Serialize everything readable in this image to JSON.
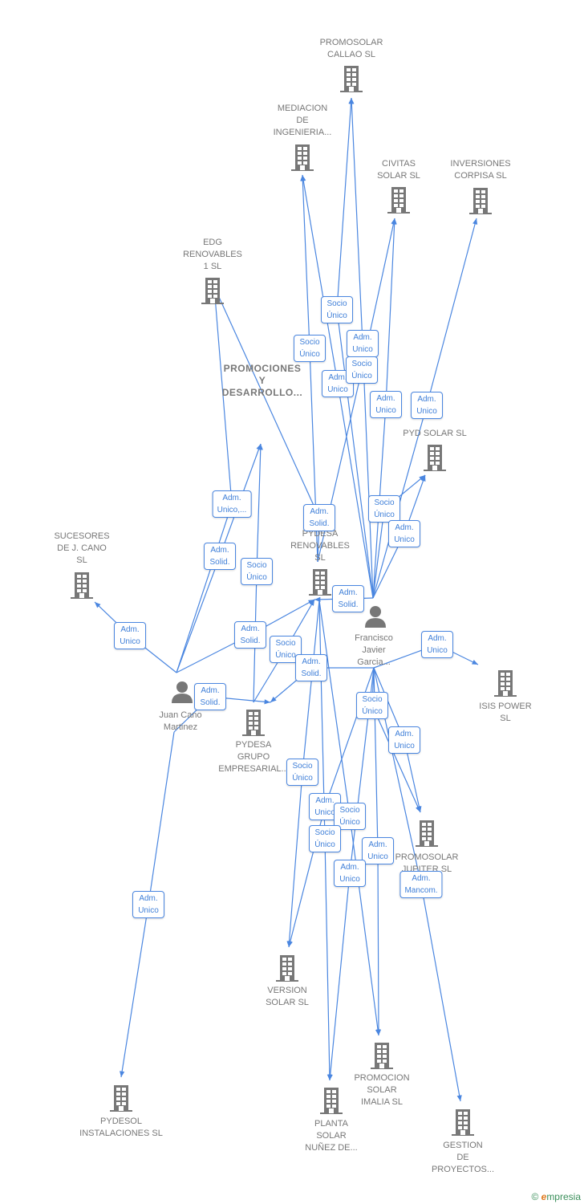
{
  "colors": {
    "edge": "#4a86e0",
    "node": "#777777",
    "brand_e": "#e07a1f",
    "brand": "#3a8f5a"
  },
  "companies": [
    {
      "id": "callao",
      "label": "PROMOSOLAR\nCALLAO  SL"
    },
    {
      "id": "mediacion",
      "label": "MEDIACION\nDE\nINGENIERIA..."
    },
    {
      "id": "civitas",
      "label": "CIVITAS\nSOLAR  SL"
    },
    {
      "id": "corpisa",
      "label": "INVERSIONES\nCORPISA  SL"
    },
    {
      "id": "edg",
      "label": "EDG\nRENOVABLES\n1  SL"
    },
    {
      "id": "promociones",
      "label": "PROMOCIONES\nY\nDESARROLLO..."
    },
    {
      "id": "pyd",
      "label": "PYD SOLAR  SL"
    },
    {
      "id": "sucesores",
      "label": "SUCESORES\nDE J.  CANO\nSL"
    },
    {
      "id": "pydesa_renov",
      "label": "PYDESA\nRENOVABLES\nSL"
    },
    {
      "id": "isis",
      "label": "ISIS POWER\nSL"
    },
    {
      "id": "pydesa_grupo",
      "label": "PYDESA\nGRUPO\nEMPRESARIAL..."
    },
    {
      "id": "jupiter",
      "label": "PROMOSOLAR\nJUPITER  SL"
    },
    {
      "id": "version",
      "label": "VERSION\nSOLAR  SL"
    },
    {
      "id": "imalia",
      "label": "PROMOCION\nSOLAR\nIMALIA  SL"
    },
    {
      "id": "pydesol",
      "label": "PYDESOL\nINSTALACIONES SL"
    },
    {
      "id": "planta",
      "label": "PLANTA\nSOLAR\nNUÑEZ DE..."
    },
    {
      "id": "gestion",
      "label": "GESTION\nDE\nPROYECTOS..."
    }
  ],
  "persons": [
    {
      "id": "francisco",
      "label": "Francisco\nJavier\nGarcia..."
    },
    {
      "id": "juan",
      "label": "Juan Cano\nMartinez"
    }
  ],
  "edges": [
    {
      "from": "francisco",
      "to": "callao",
      "label": "Socio\nÚnico"
    },
    {
      "from": "pydesa_renov",
      "to": "mediacion",
      "label": "Socio\nÚnico"
    },
    {
      "from": "francisco",
      "to": "mediacion",
      "label": "Adm.\nUnico"
    },
    {
      "from": "francisco",
      "to": "callao",
      "label": "Adm.\nUnico"
    },
    {
      "from": "pydesa_renov",
      "to": "civitas",
      "label": "Socio\nÚnico"
    },
    {
      "from": "francisco",
      "to": "civitas",
      "label": "Adm.\nUnico"
    },
    {
      "from": "francisco",
      "to": "corpisa",
      "label": "Adm.\nUnico"
    },
    {
      "from": "juan",
      "to": "edg",
      "label": "Adm.\nUnico,..."
    },
    {
      "from": "pydesa_renov",
      "to": "edg",
      "label": "Adm.\nSolid."
    },
    {
      "from": "juan",
      "to": "promociones",
      "label": "Adm.\nSolid."
    },
    {
      "from": "pydesa_grupo",
      "to": "promociones",
      "label": "Socio\nÚnico"
    },
    {
      "from": "francisco",
      "to": "pyd",
      "label": "Socio\nÚnico"
    },
    {
      "from": "francisco",
      "to": "pyd",
      "label": "Adm.\nUnico"
    },
    {
      "from": "francisco",
      "to": "pydesa_renov",
      "label": "Adm.\nSolid."
    },
    {
      "from": "juan",
      "to": "pydesa_renov",
      "label": "Adm.\nSolid."
    },
    {
      "from": "pydesa_grupo",
      "to": "pydesa_renov",
      "label": "Socio\nÚnico"
    },
    {
      "from": "francisco",
      "to": "pydesa_grupo",
      "label": "Adm.\nSolid."
    },
    {
      "from": "juan",
      "to": "sucesores",
      "label": "Adm.\nUnico"
    },
    {
      "from": "francisco",
      "to": "isis",
      "label": "Adm.\nUnico"
    },
    {
      "from": "juan",
      "to": "pydesa_grupo",
      "label": "Adm.\nSolid."
    },
    {
      "from": "francisco",
      "to": "jupiter",
      "label": "Socio\nÚnico"
    },
    {
      "from": "francisco",
      "to": "jupiter",
      "label": "Adm.\nUnico"
    },
    {
      "from": "pydesa_renov",
      "to": "version",
      "label": "Socio\nÚnico"
    },
    {
      "from": "francisco",
      "to": "version",
      "label": "Adm.\nUnico"
    },
    {
      "from": "pydesa_renov",
      "to": "imalia",
      "label": "Socio\nÚnico"
    },
    {
      "from": "pydesa_renov",
      "to": "planta",
      "label": "Socio\nÚnico"
    },
    {
      "from": "francisco",
      "to": "imalia",
      "label": "Adm.\nUnico"
    },
    {
      "from": "francisco",
      "to": "planta",
      "label": "Adm.\nUnico"
    },
    {
      "from": "francisco",
      "to": "gestion",
      "label": "Adm.\nMancom."
    },
    {
      "from": "juan",
      "to": "pydesol",
      "label": "Adm.\nUnico"
    }
  ],
  "footer": {
    "copyright": "©",
    "brand_initial": "e",
    "brand_rest": "mpresia"
  }
}
